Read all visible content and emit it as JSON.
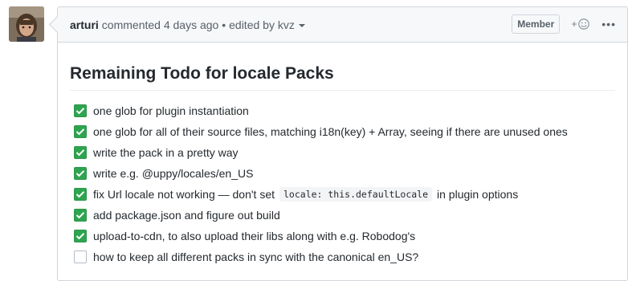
{
  "comment": {
    "author": "arturi",
    "meta": "commented 4 days ago •",
    "edited_by": "edited by kvz",
    "badge": "Member",
    "more_label": "•••"
  },
  "body": {
    "heading": "Remaining Todo for locale Packs",
    "tasks": [
      {
        "text": "one glob for plugin instantiation",
        "checked": true
      },
      {
        "text": "one glob for all of their source files, matching i18n(key) + Array, seeing if there are unused ones",
        "checked": true
      },
      {
        "text": "write the pack in a pretty way",
        "checked": true
      },
      {
        "text": "write e.g. @uppy/locales/en_US",
        "checked": true
      },
      {
        "text_before": "fix Url locale not working — don't set",
        "code": "locale: this.defaultLocale",
        "text_after": "in plugin options",
        "checked": true
      },
      {
        "text": "add package.json and figure out build",
        "checked": true
      },
      {
        "text": "upload-to-cdn, to also upload their libs along with e.g. Robodog's",
        "checked": true
      },
      {
        "text": "how to keep all different packs in sync with the canonical en_US?",
        "checked": false
      }
    ]
  },
  "colors": {
    "checkbox_checked": "#2ea44f",
    "header_bg": "#f6f8fa",
    "border": "#d1d5da"
  },
  "icons": {
    "avatar": "user-avatar",
    "reaction": "smiley-plus-icon",
    "dropdown": "caret-down-icon",
    "check": "check-icon"
  }
}
